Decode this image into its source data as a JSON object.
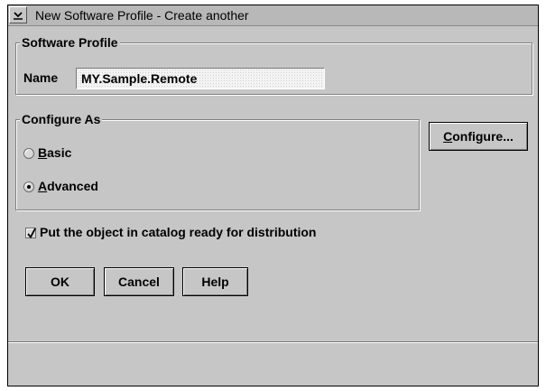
{
  "window": {
    "title": "New Software Profile - Create another",
    "system_menu_icon": "chevron-down-icon"
  },
  "software_profile": {
    "group_label": "Software Profile",
    "name_label": "Name",
    "name_value": "MY.Sample.Remote"
  },
  "configure_as": {
    "group_label": "Configure As",
    "options": [
      {
        "mnemonic": "B",
        "rest": "asic",
        "selected": false
      },
      {
        "mnemonic": "A",
        "rest": "dvanced",
        "selected": true
      }
    ]
  },
  "configure_button": {
    "mnemonic": "C",
    "rest": "onfigure..."
  },
  "catalog_checkbox": {
    "label": "Put the object in catalog ready for distribution",
    "checked": true
  },
  "buttons": {
    "ok": "OK",
    "cancel": "Cancel",
    "help": "Help"
  }
}
